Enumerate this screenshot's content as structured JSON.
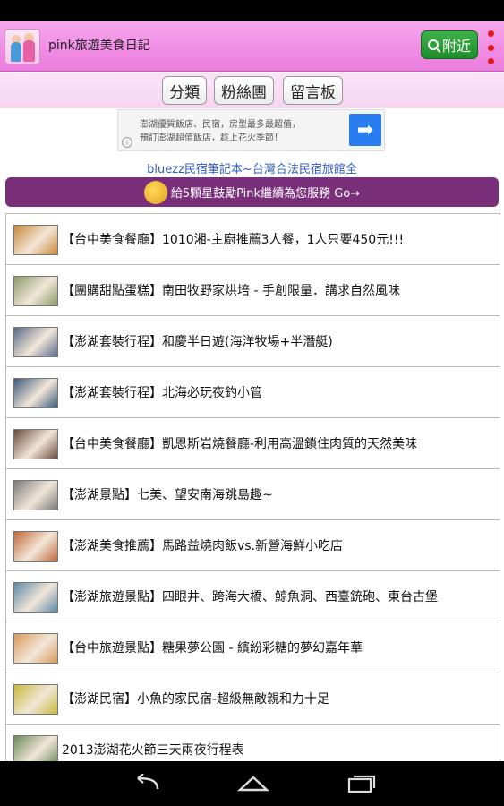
{
  "app": {
    "title": "pink旅遊美食日記",
    "nearby_label": "附近",
    "icons": {
      "logo": "app-logo-icon",
      "search": "search-icon",
      "overflow": "overflow-menu-icon"
    }
  },
  "tabs": [
    {
      "label": "分類"
    },
    {
      "label": "粉絲團"
    },
    {
      "label": "留言板"
    }
  ],
  "ad": {
    "line1": "澎湖優質飯店、民宿，房型最多最超值，",
    "line2": "預訂澎湖超值飯店，趁上花火季節！",
    "info": "i",
    "arrow": "➡",
    "link_text": "bluezz民宿筆記本~台灣合法民宿旅館全"
  },
  "promo": {
    "text": "給5顆星鼓勵Pink繼續為您服務 Go→"
  },
  "list": [
    {
      "title": "【台中美食餐廳】1010湘-主廚推薦3人餐，1人只要450元!!!",
      "thumb_color": "#c98a3a"
    },
    {
      "title": "【團購甜點蛋糕】南田牧野家烘培 - 手創限量．講求自然風味",
      "thumb_color": "#8a9a6a"
    },
    {
      "title": "【澎湖套裝行程】和慶半日遊(海洋牧場+半潛艇)",
      "thumb_color": "#5a6a8a"
    },
    {
      "title": "【澎湖套裝行程】北海必玩夜釣小管",
      "thumb_color": "#3b5a7a"
    },
    {
      "title": "【台中美食餐廳】凱恩斯岩燒餐廳-利用高溫鎖住肉質的天然美味",
      "thumb_color": "#6a4a3a"
    },
    {
      "title": "【澎湖景點】七美、望安南海跳島趣~",
      "thumb_color": "#7a7a7a"
    },
    {
      "title": "【澎湖美食推薦】馬路益燒肉飯vs.新營海鮮小吃店",
      "thumb_color": "#c06a3a"
    },
    {
      "title": "【澎湖旅遊景點】四眼井、跨海大橋、鯨魚洞、西臺銃砲、東台古堡",
      "thumb_color": "#5a8aa8"
    },
    {
      "title": "【台中旅遊景點】糖果夢公園 - 繽紛彩糖的夢幻嘉年華",
      "thumb_color": "#d89a5a"
    },
    {
      "title": "【澎湖民宿】小魚的家民宿-超級無敵親和力十足",
      "thumb_color": "#c8b83a"
    },
    {
      "title": "2013澎湖花火節三天兩夜行程表",
      "thumb_color": "#6a8a5a"
    }
  ],
  "navbar": {
    "back": "back-icon",
    "home": "home-icon",
    "recents": "recents-icon"
  },
  "colors": {
    "appbar": "#f08be4",
    "promo": "#7a2f7a",
    "nearby": "#1e8d2a",
    "link": "#3058b8"
  }
}
